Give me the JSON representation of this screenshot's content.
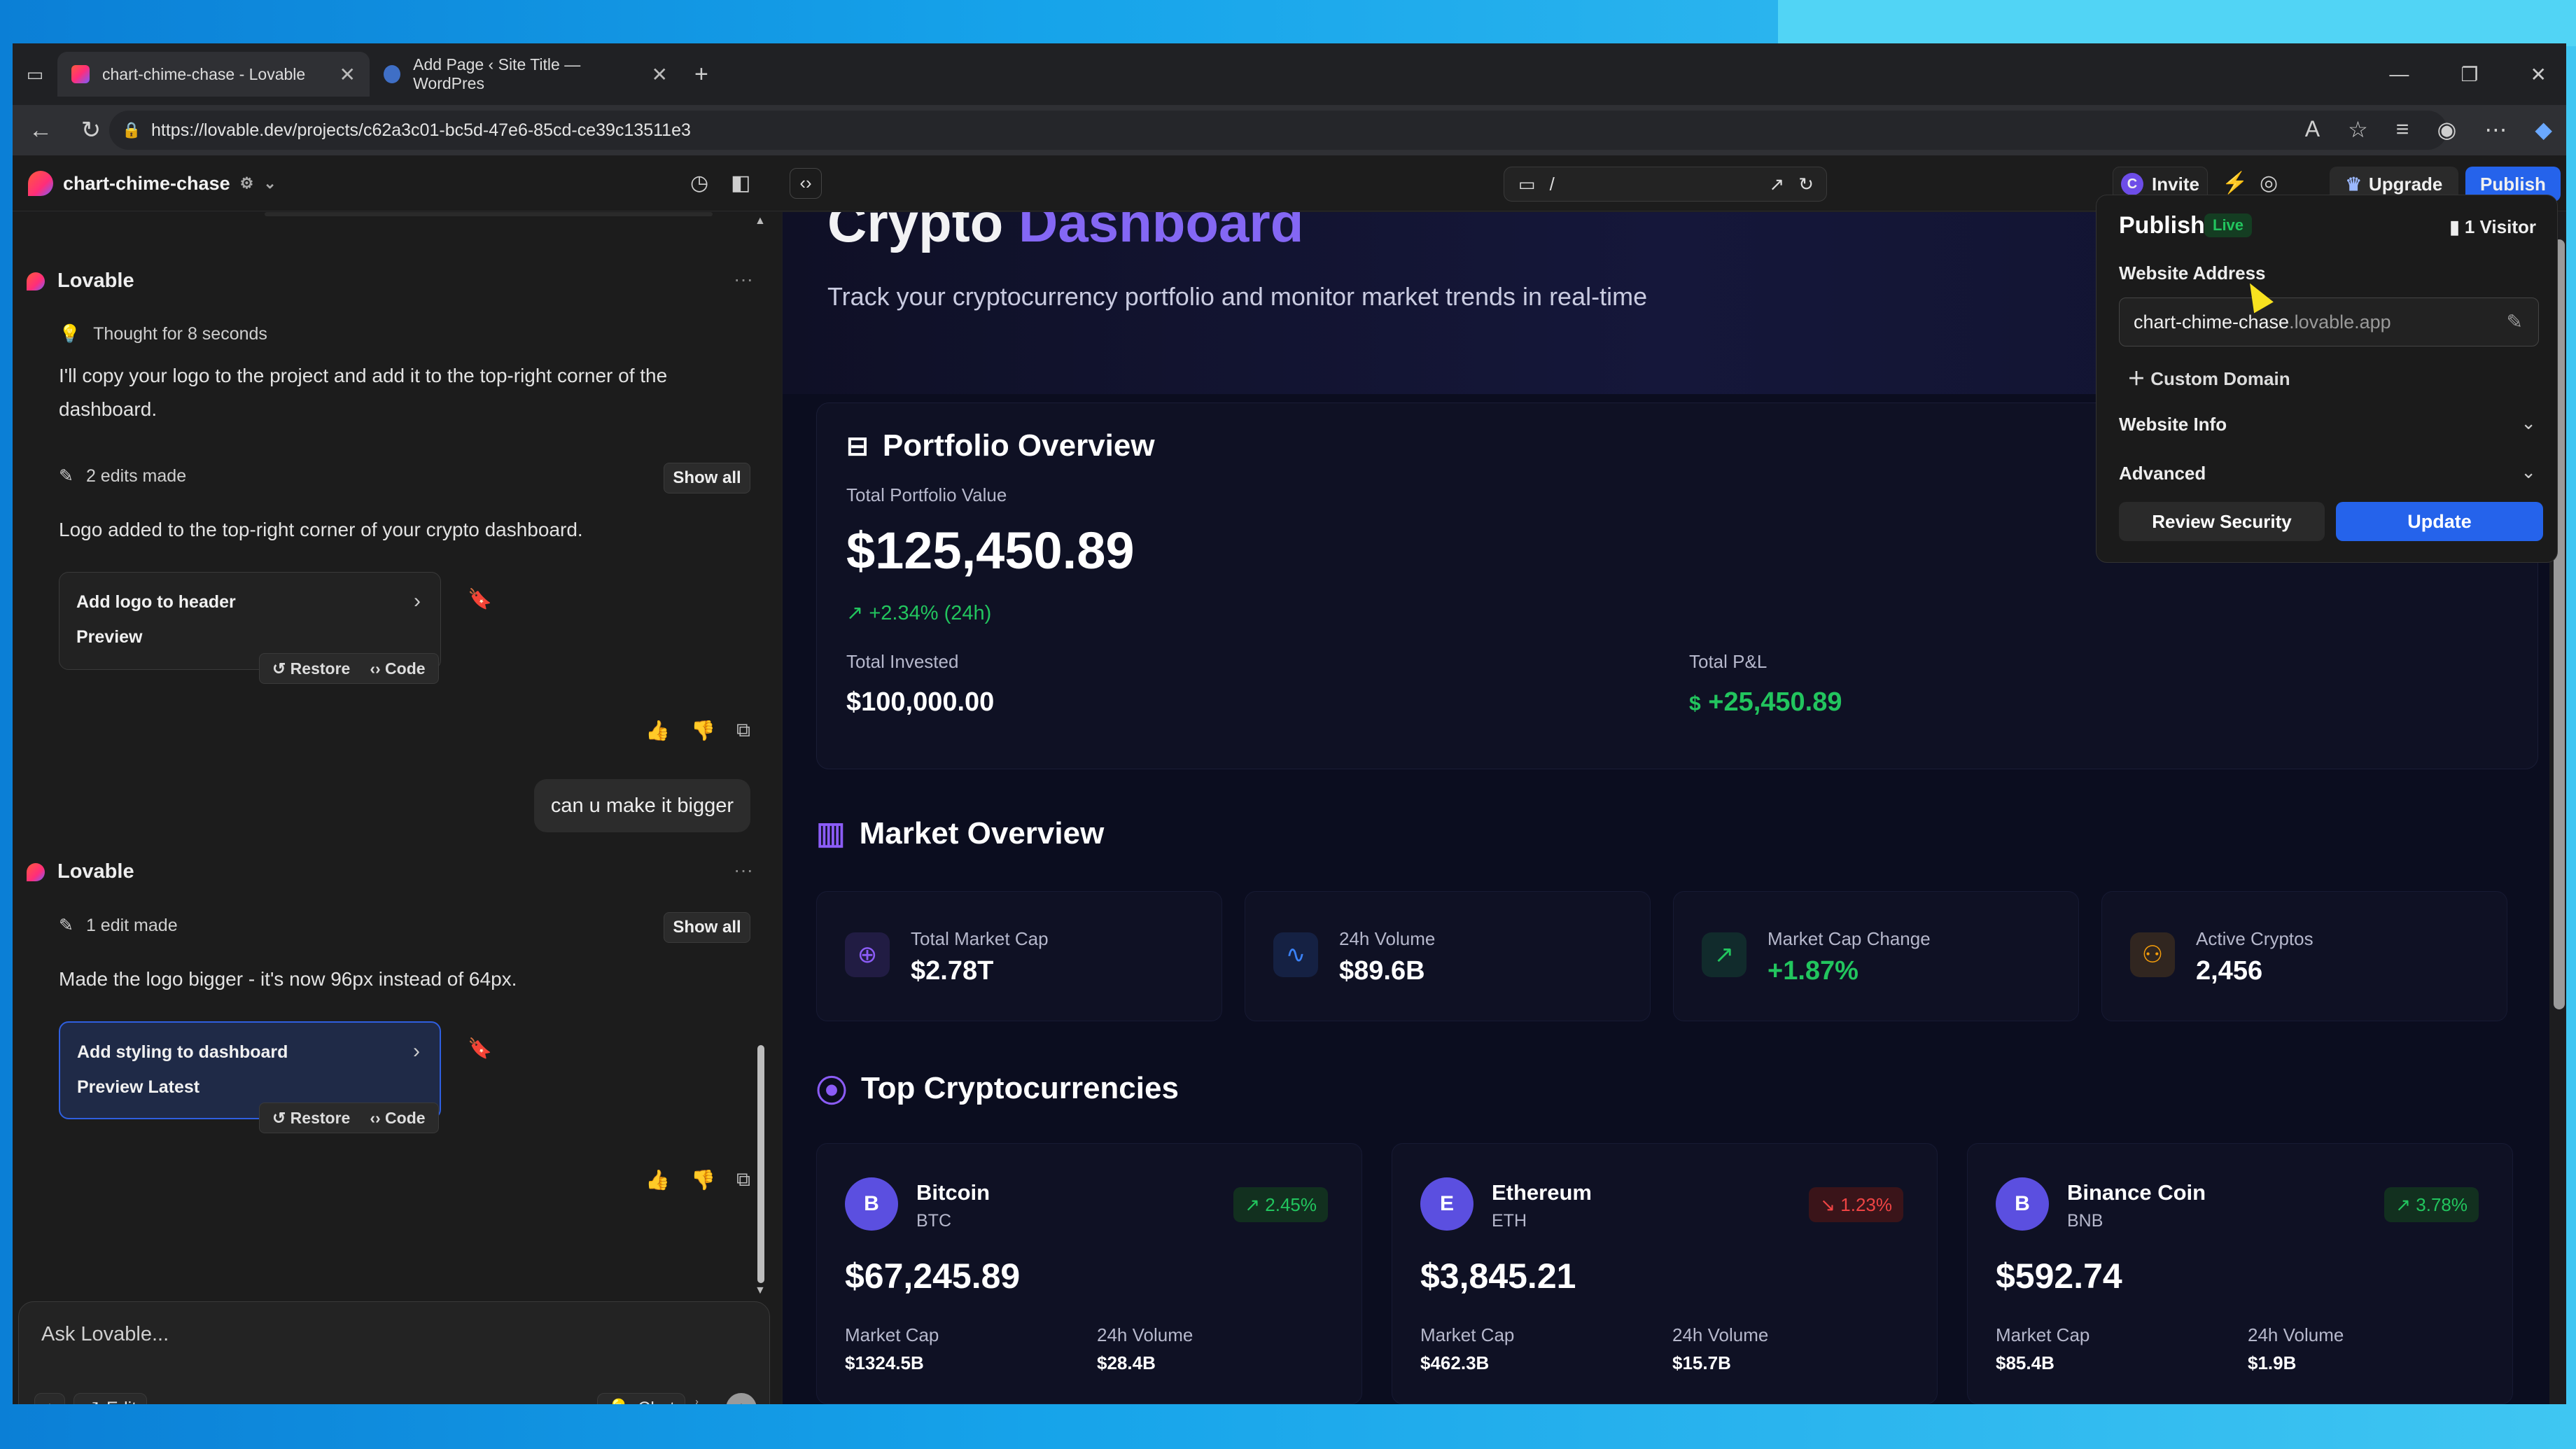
{
  "browser": {
    "tabs": [
      {
        "title": "chart-chime-chase - Lovable"
      },
      {
        "title": "Add Page ‹ Site Title — WordPres"
      }
    ],
    "new_tab": "+",
    "url": "https://lovable.dev/projects/c62a3c01-bc5d-47e6-85cd-ce39c13511e3"
  },
  "header": {
    "project_name": "chart-chime-chase",
    "path": "/",
    "invite_label": "Invite",
    "invite_avatar": "C",
    "upgrade_label": "Upgrade",
    "publish_label": "Publish"
  },
  "chat": {
    "messages": [
      {
        "sender": "Lovable",
        "thought": "Thought for 8 seconds",
        "text": "I'll copy your logo to the project and add it to the top-right corner of the dashboard.",
        "edits": "2 edits made",
        "show_all": "Show all",
        "result": "Logo added to the top-right corner of your crypto dashboard.",
        "card_title": "Add logo to header",
        "card_sub": "Preview",
        "restore": "Restore",
        "code": "Code"
      },
      {
        "user": "can u make it bigger"
      },
      {
        "sender": "Lovable",
        "edits": "1 edit made",
        "show_all": "Show all",
        "result": "Made the logo bigger - it's now 96px instead of 64px.",
        "card_title": "Add styling to dashboard",
        "card_sub": "Preview Latest",
        "restore": "Restore",
        "code": "Code"
      }
    ],
    "input_placeholder": "Ask Lovable...",
    "edit_label": "Edit",
    "chat_label": "Chat"
  },
  "dashboard": {
    "title_a": "Crypto",
    "title_b": "Dashboard",
    "subtitle": "Track your cryptocurrency portfolio and monitor market trends in real-time",
    "portfolio": {
      "heading": "Portfolio Overview",
      "total_label": "Total Portfolio Value",
      "total_value": "$125,450.89",
      "change": "+2.34% (24h)",
      "invested_label": "Total Invested",
      "invested_value": "$100,000.00",
      "pnl_label": "Total P&L",
      "pnl_currency": "$",
      "pnl_value": "+25,450.89"
    },
    "market": {
      "heading": "Market Overview",
      "stats": [
        {
          "label": "Total Market Cap",
          "value": "$2.78T",
          "icon": "globe-icon",
          "color": "#8b5cf6"
        },
        {
          "label": "24h Volume",
          "value": "$89.6B",
          "icon": "activity-icon",
          "color": "#3b82f6"
        },
        {
          "label": "Market Cap Change",
          "value": "+1.87%",
          "icon": "trending-up-icon",
          "color": "#22c55e"
        },
        {
          "label": "Active Cryptos",
          "value": "2,456",
          "icon": "users-icon",
          "color": "#f59e0b"
        }
      ]
    },
    "top": {
      "heading": "Top Cryptocurrencies",
      "market_cap_label": "Market Cap",
      "volume_label": "24h Volume",
      "coins": [
        {
          "avatar": "B",
          "name": "Bitcoin",
          "symbol": "BTC",
          "change": "2.45%",
          "direction": "up",
          "price": "$67,245.89",
          "market_cap": "$1324.5B",
          "volume": "$28.4B"
        },
        {
          "avatar": "E",
          "name": "Ethereum",
          "symbol": "ETH",
          "change": "1.23%",
          "direction": "down",
          "price": "$3,845.21",
          "market_cap": "$462.3B",
          "volume": "$15.7B"
        },
        {
          "avatar": "B",
          "name": "Binance Coin",
          "symbol": "BNB",
          "change": "3.78%",
          "direction": "up",
          "price": "$592.74",
          "market_cap": "$85.4B",
          "volume": "$1.9B"
        }
      ]
    }
  },
  "publish": {
    "title": "Publish",
    "status": "Live",
    "visitors": "1 Visitor",
    "address_label": "Website Address",
    "address_sub": "chart-chime-chase",
    "address_domain": ".lovable.app",
    "custom_domain": "Custom Domain",
    "website_info": "Website Info",
    "advanced": "Advanced",
    "review_security": "Review Security",
    "update": "Update"
  },
  "colors": {
    "accent": "#2563eb",
    "positive": "#22c55e",
    "negative": "#ef4444",
    "brand_purple": "#8b6cff"
  }
}
